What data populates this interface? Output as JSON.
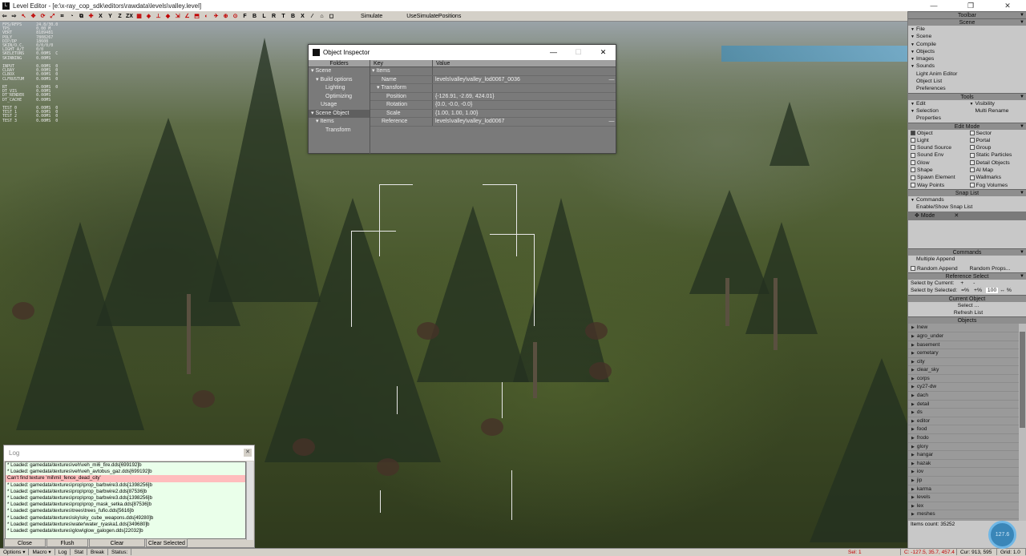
{
  "window": {
    "title": "Level Editor - [e:\\x-ray_cop_sdk\\editors\\rawdata\\levels\\valley.level]",
    "controls": [
      "—",
      "❐",
      "✕"
    ]
  },
  "toolbar": {
    "axis_buttons": [
      "X",
      "Y",
      "Z",
      "ZX"
    ],
    "view_buttons": [
      "F",
      "B",
      "L",
      "R",
      "T",
      "B",
      "X"
    ],
    "simulate": "Simulate",
    "use_sim_positions": "UseSimulatePositions"
  },
  "stats": "FPS/RFPS      24.8/30.0\nTPS           0.00 M\nVERT          8189481\nPOLY          7808267\nDIP/DP        18608\nSKIN/O.C.     0/0/0/0\nLIGHT A/T     0/0\nSKELETONS     0.00MS  C\nSKINNING      0.00MS\n\nINPUT         0.00MS  0\nCLRAY         0.00MS  0\nCLBOX         0.00MS  0\nCLFRUSTUM     0.00MS  0\n\nRT            0.00MS  0\nDT_VIS        0.00MS\nDT_RENDER     0.00MS\nDT_CACHE      0.00MS\n\nTEST 0        0.00MS  0\nTEST 1        0.00MS  0\nTEST 2        0.00MS  0\nTEST 3        0.00MS  0",
  "inspector": {
    "title": "Object Inspector",
    "folders_header": "Folders",
    "folders": [
      {
        "label": "▾ Scene",
        "indent": 0
      },
      {
        "label": "▾ Build options",
        "indent": 1
      },
      {
        "label": "Lighting",
        "indent": 3
      },
      {
        "label": "Optimizing",
        "indent": 3
      },
      {
        "label": "Usage",
        "indent": 2
      },
      {
        "label": "▾ Scene Object",
        "indent": 0,
        "selected": true
      },
      {
        "label": "▾ Items",
        "indent": 1
      },
      {
        "label": "Transform",
        "indent": 3
      }
    ],
    "key_header": "Key",
    "value_header": "Value",
    "rows": [
      {
        "key": "▾ Items",
        "value": "",
        "kindent": 0
      },
      {
        "key": "Name",
        "value": "levels\\valley\\valley_lod0067_0036",
        "kindent": 2,
        "dash": true
      },
      {
        "key": "▾ Transform",
        "value": "",
        "kindent": 1
      },
      {
        "key": "Position",
        "value": "{-126.91, -2.69, 424.01}",
        "kindent": 3
      },
      {
        "key": "Rotation",
        "value": "{0.0, -0.0, -0.0}",
        "kindent": 3
      },
      {
        "key": "Scale",
        "value": "{1.00, 1.00, 1.00}",
        "kindent": 3
      },
      {
        "key": "Reference",
        "value": "levels\\valley\\valley_lod0067",
        "kindent": 2,
        "dash": true
      }
    ]
  },
  "log": {
    "title": "Log",
    "lines": [
      {
        "text": "* Loaded: gamedata\\textures\\veh\\veh_mi6_fire.dds[699192]b",
        "error": false
      },
      {
        "text": "* Loaded: gamedata\\textures\\veh\\veh_avtobus_gaz.dds[699192]b",
        "error": false
      },
      {
        "text": "Can't find texture 'mil\\mil_fence_dead_city'",
        "error": true
      },
      {
        "text": "* Loaded: gamedata\\textures\\prop\\prop_barbwire3.dds[1398256]b",
        "error": false
      },
      {
        "text": "* Loaded: gamedata\\textures\\prop\\prop_barbwire2.dds[87536]b",
        "error": false
      },
      {
        "text": "* Loaded: gamedata\\textures\\prop\\prop_barbwire3.dds[1398256]b",
        "error": false
      },
      {
        "text": "* Loaded: gamedata\\textures\\prop\\prop_mask_setka.dds[87536]b",
        "error": false
      },
      {
        "text": "* Loaded: gamedata\\textures\\trees\\trees_fufio.dds[5616]b",
        "error": false
      },
      {
        "text": "* Loaded: gamedata\\textures\\sky\\sky_cube_weapons.dds[49280]b",
        "error": false
      },
      {
        "text": "* Loaded: gamedata\\textures\\water\\water_ryaska1.dds[349680]b",
        "error": false
      },
      {
        "text": "* Loaded: gamedata\\textures\\glow\\glow_galogen.dds[22032]b",
        "error": false
      }
    ],
    "buttons": [
      "Close",
      "Flush",
      "Clear",
      "Clear Selected"
    ]
  },
  "statusbar": {
    "left": [
      "Options ▾",
      "Macro ▾",
      "Log",
      "Stat",
      "Break",
      "Status:"
    ],
    "sel": "Sel: 1",
    "coords": "C: -127.5, 35.7, 457.4",
    "cur": "Cur: 913, 595",
    "grid": "Grid: 1.0"
  },
  "rpanel": {
    "toolbar_title": "Toolbar",
    "scene_title": "Scene",
    "scene_items": [
      "File",
      "Scene",
      "Compile",
      "Objects",
      "Images",
      "Sounds"
    ],
    "scene_links": [
      "Light Anim Editor",
      "Object List",
      "Preferences"
    ],
    "tools_title": "Tools",
    "tools_left": [
      "Edit",
      "Selection",
      "Properties"
    ],
    "tools_right": [
      "Visibility",
      "Multi Rename"
    ],
    "editmode_title": "Edit Mode",
    "editmode_left": [
      "Object",
      "Light",
      "Sound Source",
      "Sound Env",
      "Glow",
      "Shape",
      "Spawn Element",
      "Way Points"
    ],
    "editmode_right": [
      "Sector",
      "Portal",
      "Group",
      "Static Particles",
      "Detail Objects",
      "AI Map",
      "Wallmarks",
      "Fog Volumes"
    ],
    "snaplist_title": "Snap List",
    "snap_commands": "Commands",
    "snap_enable": "Enable/Show Snap List",
    "snap_mode": "Mode",
    "commands_title": "Commands",
    "multiple_append": "Multiple Append",
    "random_append": "Random Append",
    "random_props": "Random Props...",
    "refsel_title": "Reference Select",
    "select_current": "Select by Current:",
    "select_selected": "Select by Selected:",
    "refsel_plus": "+",
    "refsel_minus": "-",
    "refsel_eqpct": "=%",
    "refsel_pluspct": "+%",
    "refsel_value": "100",
    "refsel_pct": "%",
    "curobj_title": "Current Object",
    "select_btn": "Select ...",
    "refresh_btn": "Refresh List",
    "objects_title": "Objects",
    "objects": [
      "lnew",
      "agro_under",
      "basement",
      "cemetary",
      "city",
      "clear_sky",
      "corps",
      "cy27-dw",
      "dach",
      "detail",
      "ds",
      "editor",
      "food",
      "frodo",
      "glory",
      "hangar",
      "hazak",
      "iov",
      "jip",
      "karma",
      "levels",
      "lex",
      "meshes"
    ],
    "items_count": "Items count: 35252"
  },
  "bubble": "127.6"
}
